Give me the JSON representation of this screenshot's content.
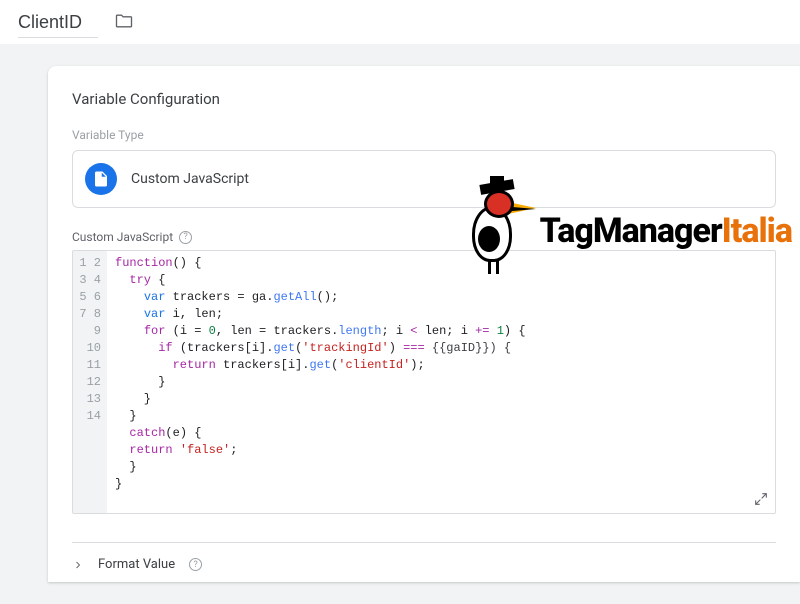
{
  "header": {
    "variable_name": "ClientID"
  },
  "card": {
    "title": "Variable Configuration",
    "variable_type_label": "Variable Type",
    "variable_type_value": "Custom JavaScript",
    "code_field_label": "Custom JavaScript",
    "format_value_label": "Format Value"
  },
  "code": {
    "line_count": 14,
    "l1_a": "function",
    "l1_b": "() {",
    "l2_a": "try",
    "l2_b": " {",
    "l3_a": "var",
    "l3_b": " trackers = ga.",
    "l3_c": "getAll",
    "l3_d": "();",
    "l4_a": "var",
    "l4_b": " i, len;",
    "l5_a": "for",
    "l5_b": " (i = ",
    "l5_c": "0",
    "l5_d": ", len = trackers.",
    "l5_e": "length",
    "l5_f": "; i ",
    "l5_g": "<",
    "l5_h": " len; i ",
    "l5_i": "+=",
    "l5_j": " ",
    "l5_k": "1",
    "l5_l": ") {",
    "l6_a": "if",
    "l6_b": " (trackers[i].",
    "l6_c": "get",
    "l6_d": "(",
    "l6_e": "'trackingId'",
    "l6_f": ") ",
    "l6_g": "===",
    "l6_h": " {{gaID}}) {",
    "l7_a": "return",
    "l7_b": " trackers[i].",
    "l7_c": "get",
    "l7_d": "(",
    "l7_e": "'clientId'",
    "l7_f": ");",
    "l8": "      }",
    "l9": "    }",
    "l10": "  }",
    "l11_a": "catch",
    "l11_b": "(e) {",
    "l12_a": "return",
    "l12_b": " ",
    "l12_c": "'false'",
    "l12_d": ";",
    "l13": "  }",
    "l14": "}"
  },
  "watermark": {
    "text_black": "TagManager",
    "text_orange": "Italia"
  }
}
